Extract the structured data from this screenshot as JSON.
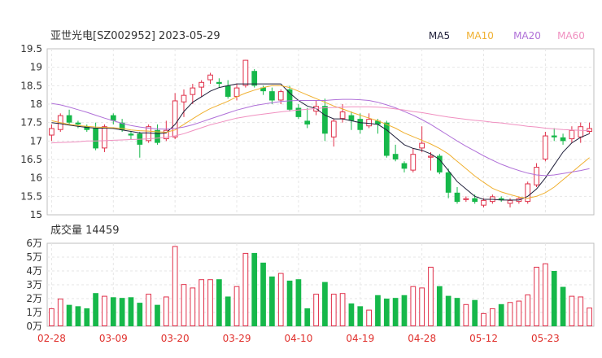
{
  "header": {
    "title": "亚世光电[SZ002952] 2023-05-29"
  },
  "legend": [
    {
      "name": "MA5",
      "color": "#1f1f3a"
    },
    {
      "name": "MA10",
      "color": "#f0b030"
    },
    {
      "name": "MA20",
      "color": "#b070d8"
    },
    {
      "name": "MA60",
      "color": "#f090c0"
    }
  ],
  "volume_label": "成交量 14459",
  "colors": {
    "up": "#e0304a",
    "down": "#16b84a",
    "axis_date": "#e0302c"
  },
  "chart_data": [
    {
      "type": "candlestick",
      "ylim": [
        15,
        19.5
      ],
      "yticks": [
        "15",
        "15.5",
        "16",
        "16.5",
        "17",
        "17.5",
        "18",
        "18.5",
        "19",
        "19.5"
      ],
      "xticks": [
        {
          "label": "02-28",
          "index": 0
        },
        {
          "label": "03-09",
          "index": 7
        },
        {
          "label": "03-20",
          "index": 14
        },
        {
          "label": "03-29",
          "index": 21
        },
        {
          "label": "04-10",
          "index": 28
        },
        {
          "label": "04-19",
          "index": 35
        },
        {
          "label": "04-28",
          "index": 42
        },
        {
          "label": "05-12",
          "index": 49
        },
        {
          "label": "05-23",
          "index": 56
        }
      ],
      "ohlc": [
        [
          17.15,
          17.45,
          17.0,
          17.35
        ],
        [
          17.3,
          17.75,
          17.25,
          17.7
        ],
        [
          17.7,
          17.85,
          17.45,
          17.5
        ],
        [
          17.5,
          17.55,
          17.35,
          17.45
        ],
        [
          17.4,
          17.45,
          17.25,
          17.3
        ],
        [
          17.35,
          17.5,
          16.75,
          16.8
        ],
        [
          16.8,
          17.45,
          16.7,
          17.4
        ],
        [
          17.7,
          17.75,
          17.45,
          17.55
        ],
        [
          17.5,
          17.6,
          17.25,
          17.3
        ],
        [
          17.2,
          17.25,
          17.05,
          17.15
        ],
        [
          17.2,
          17.25,
          16.55,
          16.9
        ],
        [
          17.0,
          17.45,
          16.95,
          17.4
        ],
        [
          17.3,
          17.45,
          16.9,
          16.95
        ],
        [
          17.05,
          17.55,
          17.0,
          17.3
        ],
        [
          17.1,
          18.3,
          17.05,
          18.1
        ],
        [
          18.05,
          18.4,
          17.65,
          18.25
        ],
        [
          18.25,
          18.55,
          18.0,
          18.45
        ],
        [
          18.45,
          18.65,
          18.2,
          18.6
        ],
        [
          18.65,
          18.85,
          18.55,
          18.8
        ],
        [
          18.6,
          18.7,
          18.45,
          18.55
        ],
        [
          18.5,
          18.65,
          18.15,
          18.2
        ],
        [
          18.2,
          18.55,
          18.1,
          18.45
        ],
        [
          18.5,
          19.2,
          18.45,
          19.2
        ],
        [
          18.9,
          18.95,
          18.45,
          18.5
        ],
        [
          18.45,
          18.5,
          18.25,
          18.35
        ],
        [
          18.35,
          18.45,
          18.0,
          18.1
        ],
        [
          18.1,
          18.4,
          18.0,
          18.35
        ],
        [
          18.4,
          18.5,
          17.8,
          17.85
        ],
        [
          17.9,
          18.0,
          17.6,
          17.65
        ],
        [
          17.55,
          17.9,
          17.35,
          17.45
        ],
        [
          17.8,
          18.1,
          17.7,
          17.95
        ],
        [
          17.95,
          18.15,
          17.0,
          17.2
        ],
        [
          17.1,
          17.6,
          16.85,
          17.55
        ],
        [
          17.6,
          18.0,
          17.5,
          17.8
        ],
        [
          17.7,
          17.8,
          17.3,
          17.55
        ],
        [
          17.6,
          17.75,
          17.2,
          17.3
        ],
        [
          17.4,
          17.75,
          17.35,
          17.6
        ],
        [
          17.55,
          17.6,
          17.2,
          17.45
        ],
        [
          17.5,
          17.55,
          16.55,
          16.6
        ],
        [
          16.65,
          16.9,
          16.45,
          16.5
        ],
        [
          16.4,
          16.45,
          16.15,
          16.25
        ],
        [
          16.2,
          16.8,
          16.15,
          16.65
        ],
        [
          16.8,
          17.4,
          16.7,
          16.95
        ],
        [
          16.55,
          16.7,
          16.2,
          16.6
        ],
        [
          16.6,
          16.65,
          16.1,
          16.15
        ],
        [
          16.15,
          16.25,
          15.45,
          15.6
        ],
        [
          15.6,
          15.75,
          15.3,
          15.35
        ],
        [
          15.4,
          15.5,
          15.35,
          15.45
        ],
        [
          15.45,
          15.55,
          15.3,
          15.35
        ],
        [
          15.25,
          15.45,
          15.2,
          15.4
        ],
        [
          15.35,
          15.55,
          15.3,
          15.5
        ],
        [
          15.45,
          15.5,
          15.35,
          15.4
        ],
        [
          15.3,
          15.45,
          15.2,
          15.4
        ],
        [
          15.35,
          15.5,
          15.3,
          15.45
        ],
        [
          15.35,
          15.9,
          15.3,
          15.85
        ],
        [
          15.8,
          16.4,
          15.75,
          16.3
        ],
        [
          16.5,
          17.25,
          16.45,
          17.15
        ],
        [
          17.15,
          17.35,
          17.0,
          17.1
        ],
        [
          17.1,
          17.2,
          16.9,
          17.0
        ],
        [
          17.05,
          17.4,
          16.95,
          17.3
        ],
        [
          17.1,
          17.5,
          16.95,
          17.4
        ],
        [
          17.25,
          17.5,
          17.2,
          17.35
        ]
      ],
      "ma5": [
        17.5,
        17.47,
        17.43,
        17.4,
        17.37,
        17.35,
        17.35,
        17.34,
        17.3,
        17.26,
        17.22,
        17.22,
        17.2,
        17.22,
        17.45,
        17.8,
        18.05,
        18.2,
        18.35,
        18.45,
        18.5,
        18.55,
        18.55,
        18.55,
        18.55,
        18.55,
        18.55,
        18.3,
        18.1,
        17.95,
        17.88,
        17.7,
        17.6,
        17.6,
        17.55,
        17.5,
        17.48,
        17.45,
        17.3,
        17.1,
        16.9,
        16.8,
        16.75,
        16.65,
        16.5,
        16.2,
        15.9,
        15.7,
        15.5,
        15.42,
        15.42,
        15.4,
        15.4,
        15.4,
        15.5,
        15.7,
        16.0,
        16.35,
        16.7,
        16.95,
        17.1,
        17.2
      ],
      "ma10": [
        17.55,
        17.5,
        17.45,
        17.42,
        17.4,
        17.38,
        17.37,
        17.36,
        17.34,
        17.3,
        17.28,
        17.27,
        17.25,
        17.24,
        17.3,
        17.45,
        17.6,
        17.75,
        17.88,
        17.98,
        18.08,
        18.2,
        18.3,
        18.38,
        18.45,
        18.5,
        18.5,
        18.45,
        18.35,
        18.25,
        18.15,
        18.05,
        17.95,
        17.87,
        17.78,
        17.7,
        17.62,
        17.55,
        17.45,
        17.35,
        17.22,
        17.12,
        17.02,
        16.92,
        16.8,
        16.65,
        16.45,
        16.25,
        16.05,
        15.88,
        15.72,
        15.62,
        15.55,
        15.48,
        15.45,
        15.5,
        15.6,
        15.75,
        15.95,
        16.15,
        16.35,
        16.55
      ],
      "ma20": [
        18.02,
        17.98,
        17.92,
        17.85,
        17.78,
        17.7,
        17.62,
        17.55,
        17.48,
        17.42,
        17.38,
        17.35,
        17.33,
        17.32,
        17.34,
        17.38,
        17.44,
        17.52,
        17.6,
        17.68,
        17.76,
        17.84,
        17.9,
        17.96,
        18.0,
        18.04,
        18.07,
        18.09,
        18.1,
        18.1,
        18.1,
        18.1,
        18.12,
        18.13,
        18.13,
        18.12,
        18.1,
        18.05,
        17.98,
        17.9,
        17.8,
        17.7,
        17.58,
        17.45,
        17.3,
        17.15,
        17.0,
        16.86,
        16.73,
        16.6,
        16.48,
        16.37,
        16.28,
        16.2,
        16.13,
        16.08,
        16.06,
        16.08,
        16.12,
        16.16,
        16.2,
        16.25
      ],
      "ma60": [
        16.95,
        16.96,
        16.97,
        16.98,
        17.0,
        17.0,
        17.01,
        17.02,
        17.03,
        17.04,
        17.05,
        17.06,
        17.08,
        17.1,
        17.14,
        17.2,
        17.28,
        17.36,
        17.44,
        17.5,
        17.56,
        17.62,
        17.66,
        17.7,
        17.73,
        17.76,
        17.79,
        17.82,
        17.84,
        17.86,
        17.88,
        17.9,
        17.91,
        17.92,
        17.93,
        17.93,
        17.93,
        17.92,
        17.9,
        17.87,
        17.84,
        17.8,
        17.77,
        17.73,
        17.69,
        17.65,
        17.62,
        17.59,
        17.56,
        17.54,
        17.51,
        17.49,
        17.46,
        17.43,
        17.4,
        17.38,
        17.35,
        17.33,
        17.31,
        17.3,
        17.29,
        17.28
      ]
    },
    {
      "type": "bar",
      "name": "volume",
      "ylim": [
        0,
        60000
      ],
      "yticks": [
        "0万",
        "1万",
        "2万",
        "3万",
        "4万",
        "5万",
        "6万"
      ],
      "values": [
        13000,
        20000,
        15500,
        14500,
        13000,
        24000,
        22000,
        21000,
        20500,
        21000,
        17000,
        23500,
        15500,
        21500,
        58000,
        30500,
        28000,
        34000,
        34000,
        34000,
        21500,
        29000,
        53000,
        53000,
        46000,
        36000,
        38500,
        33000,
        34000,
        13000,
        23500,
        32000,
        23500,
        24000,
        16500,
        14500,
        12000,
        22500,
        20000,
        20500,
        22500,
        29000,
        28000,
        43000,
        29000,
        22000,
        20500,
        16000,
        19000,
        9500,
        13000,
        16000,
        17500,
        18500,
        23000,
        43000,
        45500,
        40000,
        28500,
        22000,
        21500,
        13500
      ]
    }
  ]
}
